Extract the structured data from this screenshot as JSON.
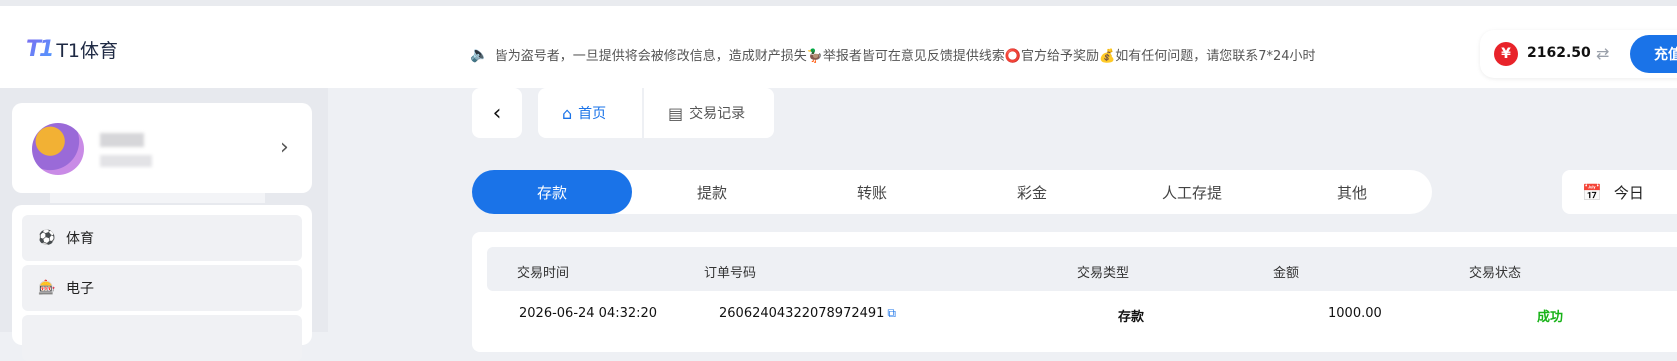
{
  "header": {
    "logo_mark": "T1",
    "logo_text": "T1体育",
    "announcement": "皆为盗号者，一旦提供将会被修改信息，造成财产损失🦆举报者皆可在意见反馈提供线索⭕官方给予奖励💰如有任何问题，请您联系7*24小时",
    "balance": "2162.50",
    "currency_symbol": "¥",
    "recharge_label": "充值"
  },
  "sidebar": {
    "menu": [
      {
        "label": "体育",
        "icon": "soccer-ball-icon"
      },
      {
        "label": "电子",
        "icon": "slot-machine-icon"
      }
    ]
  },
  "nav_tabs": [
    {
      "label": "首页",
      "icon": "home-icon",
      "active": true
    },
    {
      "label": "交易记录",
      "icon": "ledger-icon",
      "active": false
    }
  ],
  "type_tabs": [
    {
      "label": "存款",
      "active": true
    },
    {
      "label": "提款",
      "active": false
    },
    {
      "label": "转账",
      "active": false
    },
    {
      "label": "彩金",
      "active": false
    },
    {
      "label": "人工存提",
      "active": false
    },
    {
      "label": "其他",
      "active": false
    }
  ],
  "date_filter": {
    "label": "今日"
  },
  "table": {
    "headers": [
      "交易时间",
      "订单号码",
      "交易类型",
      "金额",
      "交易状态"
    ],
    "rows": [
      {
        "time": "2026-06-24 04:32:20",
        "order": "26062404322078972491",
        "type": "存款",
        "amount": "1000.00",
        "status": "成功"
      }
    ]
  },
  "colors": {
    "accent": "#1a73e8",
    "success": "#18b318",
    "danger": "#e8232a"
  }
}
